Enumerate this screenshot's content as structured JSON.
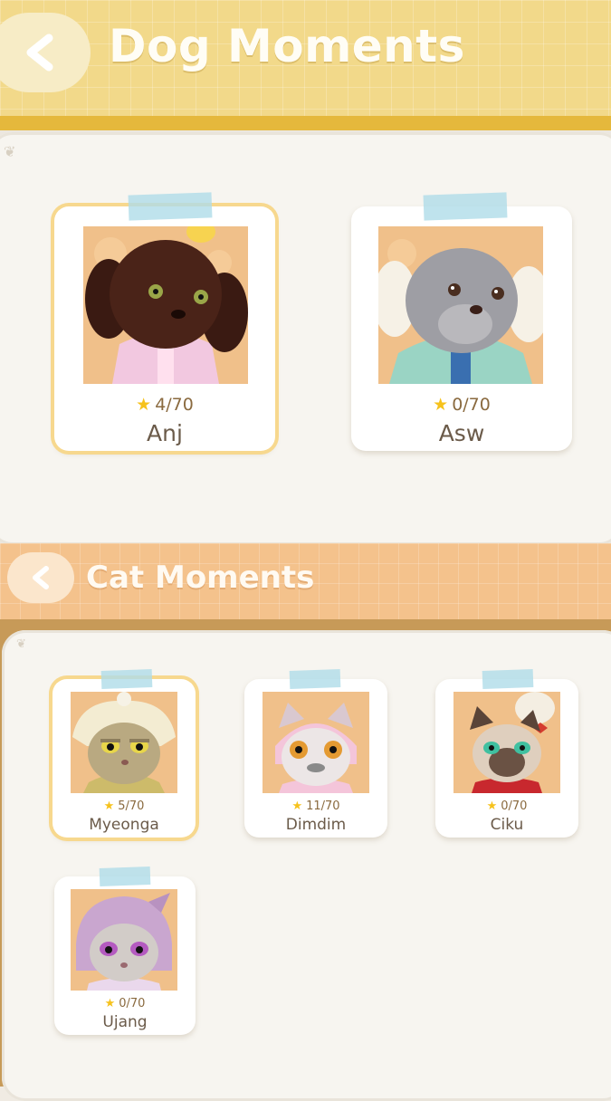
{
  "dog_section": {
    "title": "Dog Moments",
    "back_icon": "chevron-left-icon",
    "cards": [
      {
        "name": "Anj",
        "progress": "4/70",
        "selected": true
      },
      {
        "name": "Asw",
        "progress": "0/70",
        "selected": false
      }
    ]
  },
  "cat_section": {
    "title": "Cat Moments",
    "back_icon": "chevron-left-icon",
    "cards": [
      {
        "name": "Myeonga",
        "progress": "5/70",
        "selected": true
      },
      {
        "name": "Dimdim",
        "progress": "11/70",
        "selected": false
      },
      {
        "name": "Ciku",
        "progress": "0/70",
        "selected": false
      },
      {
        "name": "Ujang",
        "progress": "0/70",
        "selected": false
      }
    ]
  },
  "colors": {
    "dog_header": "#f2d98a",
    "cat_header": "#f4c28c",
    "selected_outline": "#f7d88e",
    "star": "#f6c21c"
  }
}
